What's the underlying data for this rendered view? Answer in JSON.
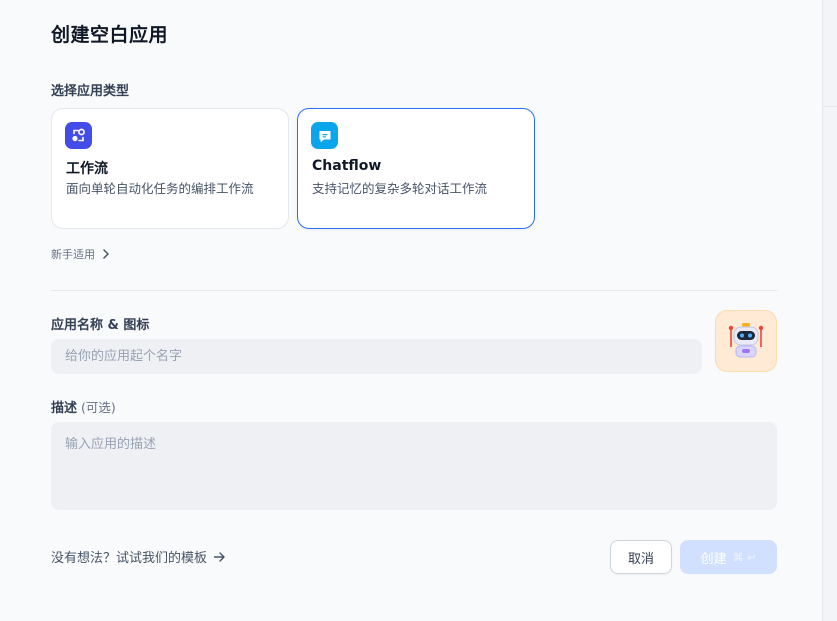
{
  "dialog": {
    "title": "创建空白应用",
    "type_section_label": "选择应用类型",
    "app_types": [
      {
        "title": "工作流",
        "description": "面向单轮自动化任务的编排工作流",
        "icon": "workflow-icon",
        "selected": false
      },
      {
        "title": "Chatflow",
        "description": "支持记忆的复杂多轮对话工作流",
        "icon": "chat-bubble-icon",
        "selected": true
      }
    ],
    "beginner_link": "新手适用",
    "name_section_label": "应用名称 & 图标",
    "name_input": {
      "value": "",
      "placeholder": "给你的应用起个名字"
    },
    "app_icon": "robot-icon",
    "description_label": "描述",
    "description_optional": "(可选)",
    "description_input": {
      "value": "",
      "placeholder": "输入应用的描述"
    },
    "template_link": "没有想法？试试我们的模板",
    "cancel_label": "取消",
    "create_label": "创建",
    "create_shortcut": "⌘ ↵"
  },
  "colors": {
    "accent": "#2970ff",
    "workflow_icon_bg": "#444ce7",
    "chatflow_icon_bg": "#0ba5ec",
    "app_icon_bg": "#ffead5",
    "create_disabled_bg": "#d1e0ff"
  }
}
